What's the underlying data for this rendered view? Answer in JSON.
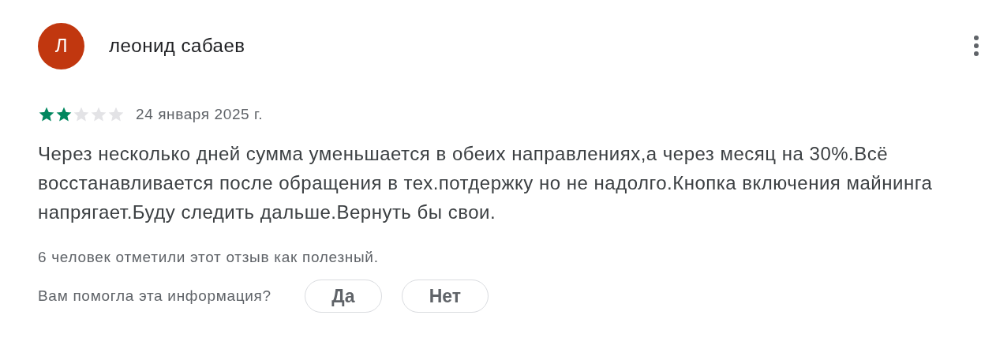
{
  "review": {
    "avatar_letter": "Л",
    "author": "леонид сабаев",
    "stars": 2,
    "date": "24 января 2025 г.",
    "text": "Через несколько дней сумма уменьшается в обеих направлениях,а через месяц на 30%.Всё восстанавливается после обращения в тех.потдержку но не надолго.Кнопка включения майнинга напрягает.Буду следить дальше.Вернуть бы свои.",
    "helpful_count": "6 человек отметили этот отзыв как полезный.",
    "question": "Вам помогла эта информация?",
    "buttons": [
      "Да",
      "Нет"
    ]
  }
}
